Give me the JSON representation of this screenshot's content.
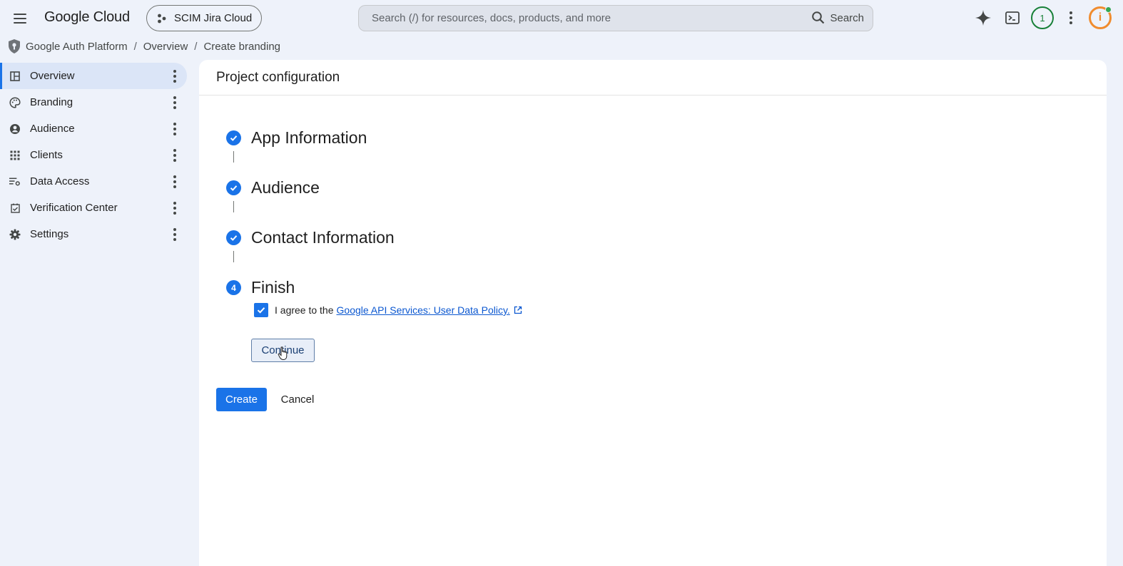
{
  "header": {
    "logo": "Google Cloud",
    "project_name": "SCIM Jira Cloud",
    "search_placeholder": "Search (/) for resources, docs, products, and more",
    "search_button": "Search",
    "notification_count": "1",
    "avatar_letter": "i"
  },
  "breadcrumb": {
    "root": "Google Auth Platform",
    "overview": "Overview",
    "current": "Create branding"
  },
  "sidebar": {
    "items": [
      {
        "label": "Overview",
        "icon": "dashboard-icon",
        "active": true
      },
      {
        "label": "Branding",
        "icon": "palette-icon"
      },
      {
        "label": "Audience",
        "icon": "person-circle-icon"
      },
      {
        "label": "Clients",
        "icon": "grid-icon"
      },
      {
        "label": "Data Access",
        "icon": "data-settings-icon"
      },
      {
        "label": "Verification Center",
        "icon": "checkbox-calendar-icon"
      },
      {
        "label": "Settings",
        "icon": "gear-icon"
      }
    ]
  },
  "main": {
    "title": "Project configuration",
    "steps": [
      {
        "title": "App Information",
        "status": "done"
      },
      {
        "title": "Audience",
        "status": "done"
      },
      {
        "title": "Contact Information",
        "status": "done"
      },
      {
        "title": "Finish",
        "number": "4",
        "status": "current"
      }
    ],
    "agree_text": "I agree to the",
    "policy_link": "Google API Services: User Data Policy.",
    "continue_label": "Continue",
    "create_label": "Create",
    "cancel_label": "Cancel"
  },
  "colors": {
    "primary": "#1a73e8",
    "background": "#eef2fa",
    "notification": "#188038",
    "avatar": "#f08c2e"
  }
}
